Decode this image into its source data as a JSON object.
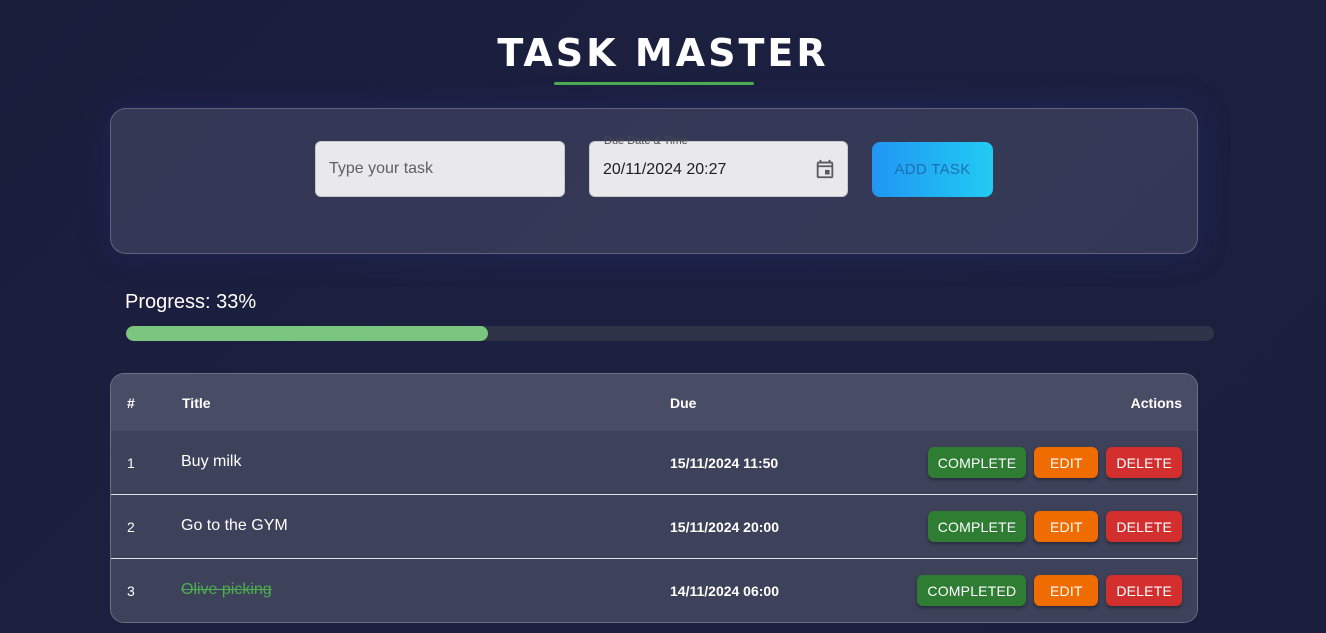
{
  "app": {
    "title": "TASK MASTER"
  },
  "form": {
    "task_placeholder": "Type your task",
    "task_value": "",
    "date_label": "Due Date & Time",
    "date_value": "20/11/2024 20:27",
    "add_label": "ADD TASK"
  },
  "progress": {
    "label": "Progress: 33%",
    "fraction": 0.333
  },
  "table": {
    "headers": {
      "num": "#",
      "title": "Title",
      "due": "Due",
      "actions": "Actions"
    },
    "rows": [
      {
        "num": "1",
        "title": "Buy milk",
        "due": "15/11/2024 11:50",
        "completed": false,
        "complete_label": "COMPLETE",
        "edit_label": "EDIT",
        "delete_label": "DELETE"
      },
      {
        "num": "2",
        "title": "Go to the GYM",
        "due": "15/11/2024 20:00",
        "completed": false,
        "complete_label": "COMPLETE",
        "edit_label": "EDIT",
        "delete_label": "DELETE"
      },
      {
        "num": "3",
        "title": "Olive picking",
        "due": "14/11/2024 06:00",
        "completed": true,
        "complete_label": "COMPLETED",
        "edit_label": "EDIT",
        "delete_label": "DELETE"
      }
    ]
  },
  "colors": {
    "accent_green": "#4caf50",
    "progress_fill": "#7bc67e",
    "complete_button": "#2e7d32",
    "edit_button": "#ef6c00",
    "delete_button": "#d32f2f",
    "add_button_start": "#2196f3",
    "add_button_end": "#21cbf3"
  }
}
